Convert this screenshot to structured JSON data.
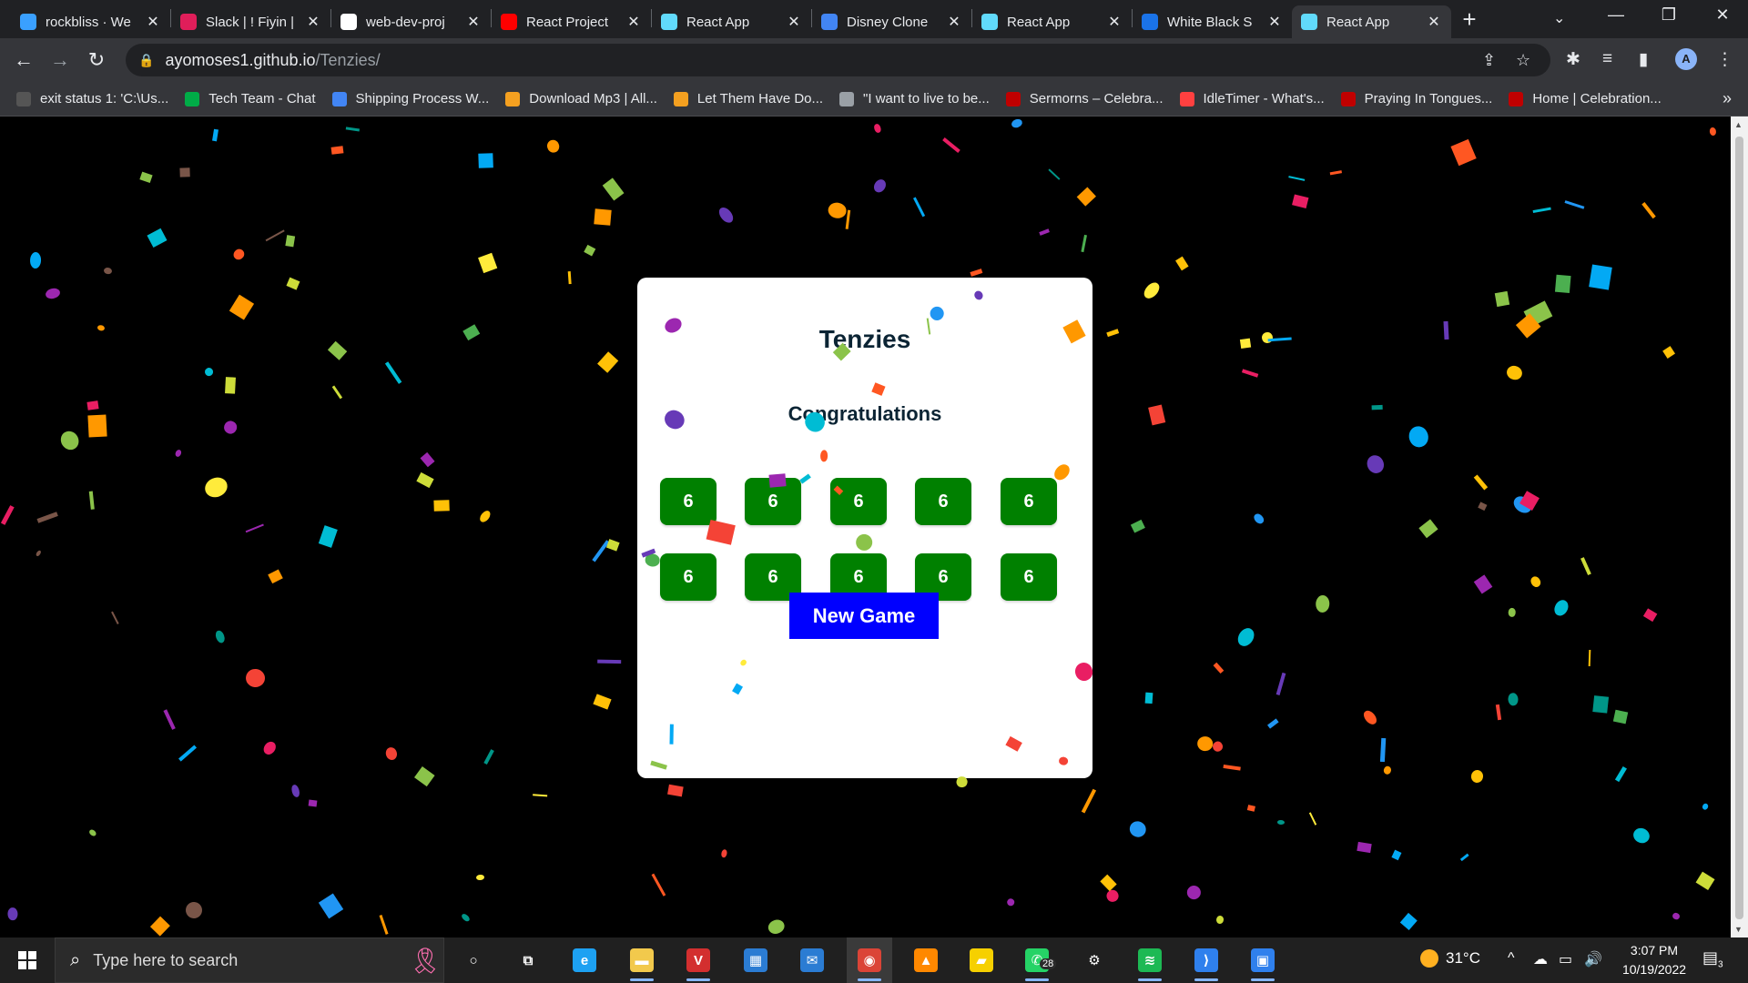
{
  "browser": {
    "tabs": [
      {
        "title": "rockbliss · We",
        "favicon_color": "#3aa0ff",
        "favicon_glyph": "",
        "active": false
      },
      {
        "title": "Slack | ! Fiyin |",
        "favicon_color": "#e01e5a",
        "favicon_glyph": "",
        "active": false
      },
      {
        "title": "web-dev-proj",
        "favicon_color": "#ffffff",
        "favicon_glyph": "",
        "active": false
      },
      {
        "title": "React Project",
        "favicon_color": "#ff0000",
        "favicon_glyph": "",
        "active": false
      },
      {
        "title": "React App",
        "favicon_color": "#61dafb",
        "favicon_glyph": "",
        "active": false
      },
      {
        "title": "Disney Clone",
        "favicon_color": "#4285f4",
        "favicon_glyph": "",
        "active": false
      },
      {
        "title": "React App",
        "favicon_color": "#61dafb",
        "favicon_glyph": "",
        "active": false
      },
      {
        "title": "White Black S",
        "favicon_color": "#1a73e8",
        "favicon_glyph": "",
        "active": false
      },
      {
        "title": "React App",
        "favicon_color": "#61dafb",
        "favicon_glyph": "",
        "active": true
      }
    ],
    "close_glyph": "✕",
    "new_tab_glyph": "+",
    "tab_search_glyph": "⌄",
    "window_controls": {
      "minimize": "—",
      "restore": "❐",
      "close": "✕"
    },
    "nav": {
      "back": "←",
      "forward": "→",
      "reload": "↻"
    },
    "lock_glyph": "🔒",
    "url_host": "ayomoses1.github.io",
    "url_path": "/Tenzies/",
    "omnibox_icons": {
      "share": "⇪",
      "star": "☆"
    },
    "toolbar_icons": {
      "extensions": "✱",
      "media": "≡",
      "sidepanel": "▮",
      "menu": "⋮"
    },
    "profile_initial": "A",
    "bookmarks": [
      {
        "label": "exit status 1: 'C:\\Us...",
        "color": "#555555"
      },
      {
        "label": "Tech Team - Chat",
        "color": "#00ac47"
      },
      {
        "label": "Shipping Process W...",
        "color": "#4285f4"
      },
      {
        "label": "Download Mp3 | All...",
        "color": "#f4a020"
      },
      {
        "label": "Let Them Have Do...",
        "color": "#f4a020"
      },
      {
        "label": "\"I want to live to be...",
        "color": "#9aa0a6"
      },
      {
        "label": "Sermorns – Celebra...",
        "color": "#c00000"
      },
      {
        "label": "IdleTimer - What's...",
        "color": "#ff4040"
      },
      {
        "label": "Praying In Tongues...",
        "color": "#c00000"
      },
      {
        "label": "Home | Celebration...",
        "color": "#c00000"
      }
    ],
    "bookmarks_more": "»"
  },
  "app": {
    "title": "Tenzies",
    "status": "Congratulations",
    "dice": [
      6,
      6,
      6,
      6,
      6,
      6,
      6,
      6,
      6,
      6
    ],
    "die_color": "#008000",
    "button_label": "New Game",
    "button_color": "#0000ff"
  },
  "taskbar": {
    "search_placeholder": "Type here to search",
    "search_glyph": "⌕",
    "ribbon_glyph": "🎗",
    "apps": [
      {
        "name": "cortana",
        "glyph": "○",
        "color": "transparent",
        "running": false,
        "active": false
      },
      {
        "name": "task-view",
        "glyph": "⧉",
        "color": "transparent",
        "running": false,
        "active": false
      },
      {
        "name": "edge",
        "glyph": "e",
        "color": "#1da1f2",
        "running": false,
        "active": false
      },
      {
        "name": "file-explorer",
        "glyph": "▬",
        "color": "#f2c94c",
        "running": true,
        "active": false
      },
      {
        "name": "vector-app",
        "glyph": "V",
        "color": "#d32f2f",
        "running": true,
        "active": false
      },
      {
        "name": "store",
        "glyph": "▦",
        "color": "#2b7cd3",
        "running": false,
        "active": false
      },
      {
        "name": "mail",
        "glyph": "✉",
        "color": "#2b7cd3",
        "running": false,
        "active": false
      },
      {
        "name": "chrome",
        "glyph": "◉",
        "color": "#db4437",
        "running": true,
        "active": true
      },
      {
        "name": "vlc",
        "glyph": "▲",
        "color": "#ff8800",
        "running": false,
        "active": false
      },
      {
        "name": "sticky-notes",
        "glyph": "▰",
        "color": "#f6d000",
        "running": false,
        "active": false
      },
      {
        "name": "whatsapp",
        "glyph": "✆",
        "color": "#25d366",
        "running": true,
        "active": false
      },
      {
        "name": "settings",
        "glyph": "⚙",
        "color": "transparent",
        "running": false,
        "active": false
      },
      {
        "name": "spotify",
        "glyph": "≋",
        "color": "#1db954",
        "running": true,
        "active": false
      },
      {
        "name": "vscode",
        "glyph": "⟩",
        "color": "#2f80ed",
        "running": true,
        "active": false
      },
      {
        "name": "photos",
        "glyph": "▣",
        "color": "#2f80ed",
        "running": true,
        "active": false
      }
    ],
    "whatsapp_badge": "28",
    "temperature": "31°C",
    "tray_icons": {
      "chevron": "^",
      "onedrive": "☁",
      "battery": "▭",
      "volume": "🔊"
    },
    "time": "3:07 PM",
    "date": "10/19/2022",
    "notification_glyph": "▤",
    "notification_count": "3"
  },
  "confetti_palette": [
    "#ff5722",
    "#ffc107",
    "#8bc34a",
    "#2196f3",
    "#9c27b0",
    "#e91e63",
    "#00bcd4",
    "#ff9800",
    "#cddc39",
    "#673ab7",
    "#009688",
    "#f44336",
    "#03a9f4",
    "#795548",
    "#4caf50",
    "#ffeb3b"
  ]
}
